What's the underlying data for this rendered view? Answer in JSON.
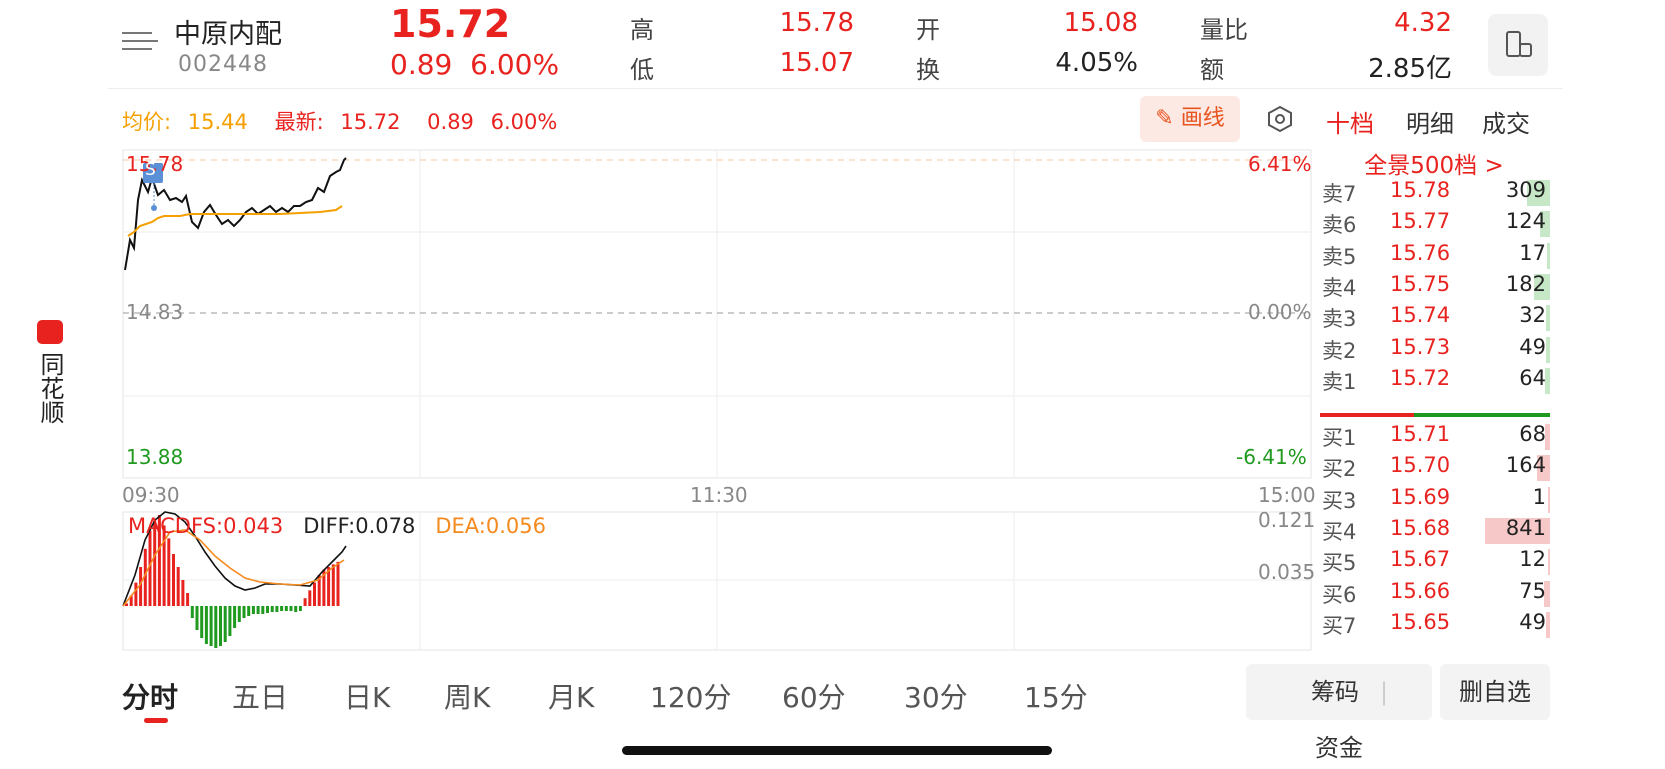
{
  "app": {
    "name": "同花顺"
  },
  "header": {
    "stock_name": "中原内配",
    "stock_code": "002448",
    "price": "15.72",
    "change": "0.89",
    "change_pct": "6.00%",
    "high_label": "高",
    "high": "15.78",
    "low_label": "低",
    "low": "15.07",
    "open_label": "开",
    "open": "15.08",
    "turnover_label": "换",
    "turnover": "4.05%",
    "volume_ratio_label": "量比",
    "volume_ratio": "4.32",
    "amount_label": "额",
    "amount": "2.85亿"
  },
  "info": {
    "avg_label": "均价:",
    "avg": "15.44",
    "latest_label": "最新:",
    "latest": "15.72",
    "change": "0.89",
    "change_pct": "6.00%",
    "draw_button": "画线"
  },
  "chart": {
    "price_top": "15.78",
    "price_mid": "14.83",
    "price_bottom": "13.88",
    "pct_top": "6.41%",
    "pct_mid": "0.00%",
    "pct_bottom": "-6.41%",
    "time_start": "09:30",
    "time_mid": "11:30",
    "time_end": "15:00",
    "marker": "S",
    "macd_label": "MACDFS:",
    "macd": "0.043",
    "diff_label": "DIFF:",
    "diff": "0.078",
    "dea_label": "DEA:",
    "dea": "0.056",
    "macd_top": "0.121",
    "macd_mid": "0.035",
    "colors": {
      "price_line": "#111111",
      "avg_line": "#f5a000",
      "up": "#e8231f",
      "down": "#1f9a1f"
    }
  },
  "orderbook": {
    "tabs": [
      "十档",
      "明细",
      "成交"
    ],
    "active_tab": "十档",
    "panorama": "全景500档 >",
    "sells": [
      {
        "label": "卖7",
        "price": "15.78",
        "vol": "309",
        "bar": 0.18,
        "color": "#1f9a1f"
      },
      {
        "label": "卖6",
        "price": "15.77",
        "vol": "124",
        "bar": 0.08,
        "color": "#1f9a1f"
      },
      {
        "label": "卖5",
        "price": "15.76",
        "vol": "17",
        "bar": 0.02,
        "color": "#1f9a1f"
      },
      {
        "label": "卖4",
        "price": "15.75",
        "vol": "182",
        "bar": 0.12,
        "color": "#1f9a1f"
      },
      {
        "label": "卖3",
        "price": "15.74",
        "vol": "32",
        "bar": 0.03,
        "color": "#1f9a1f"
      },
      {
        "label": "卖2",
        "price": "15.73",
        "vol": "49",
        "bar": 0.03,
        "color": "#1f9a1f"
      },
      {
        "label": "卖1",
        "price": "15.72",
        "vol": "64",
        "bar": 0.04,
        "color": "#1f9a1f"
      }
    ],
    "buys": [
      {
        "label": "买1",
        "price": "15.71",
        "vol": "68",
        "bar": 0.04,
        "color": "#e8231f"
      },
      {
        "label": "买2",
        "price": "15.70",
        "vol": "164",
        "bar": 0.1,
        "color": "#e8231f"
      },
      {
        "label": "买3",
        "price": "15.69",
        "vol": "1",
        "bar": 0.0,
        "color": "#e8231f"
      },
      {
        "label": "买4",
        "price": "15.68",
        "vol": "841",
        "bar": 0.5,
        "color": "#e8231f"
      },
      {
        "label": "买5",
        "price": "15.67",
        "vol": "12",
        "bar": 0.01,
        "color": "#e8231f"
      },
      {
        "label": "买6",
        "price": "15.66",
        "vol": "75",
        "bar": 0.05,
        "color": "#e8231f"
      },
      {
        "label": "买7",
        "price": "15.65",
        "vol": "49",
        "bar": 0.03,
        "color": "#e8231f"
      }
    ]
  },
  "periods": [
    "分时",
    "五日",
    "日K",
    "周K",
    "月K",
    "120分",
    "60分",
    "30分",
    "15分"
  ],
  "active_period": "分时",
  "bottom_buttons": {
    "chips": "筹码",
    "funds": "资金",
    "remove_watch": "删自选"
  }
}
